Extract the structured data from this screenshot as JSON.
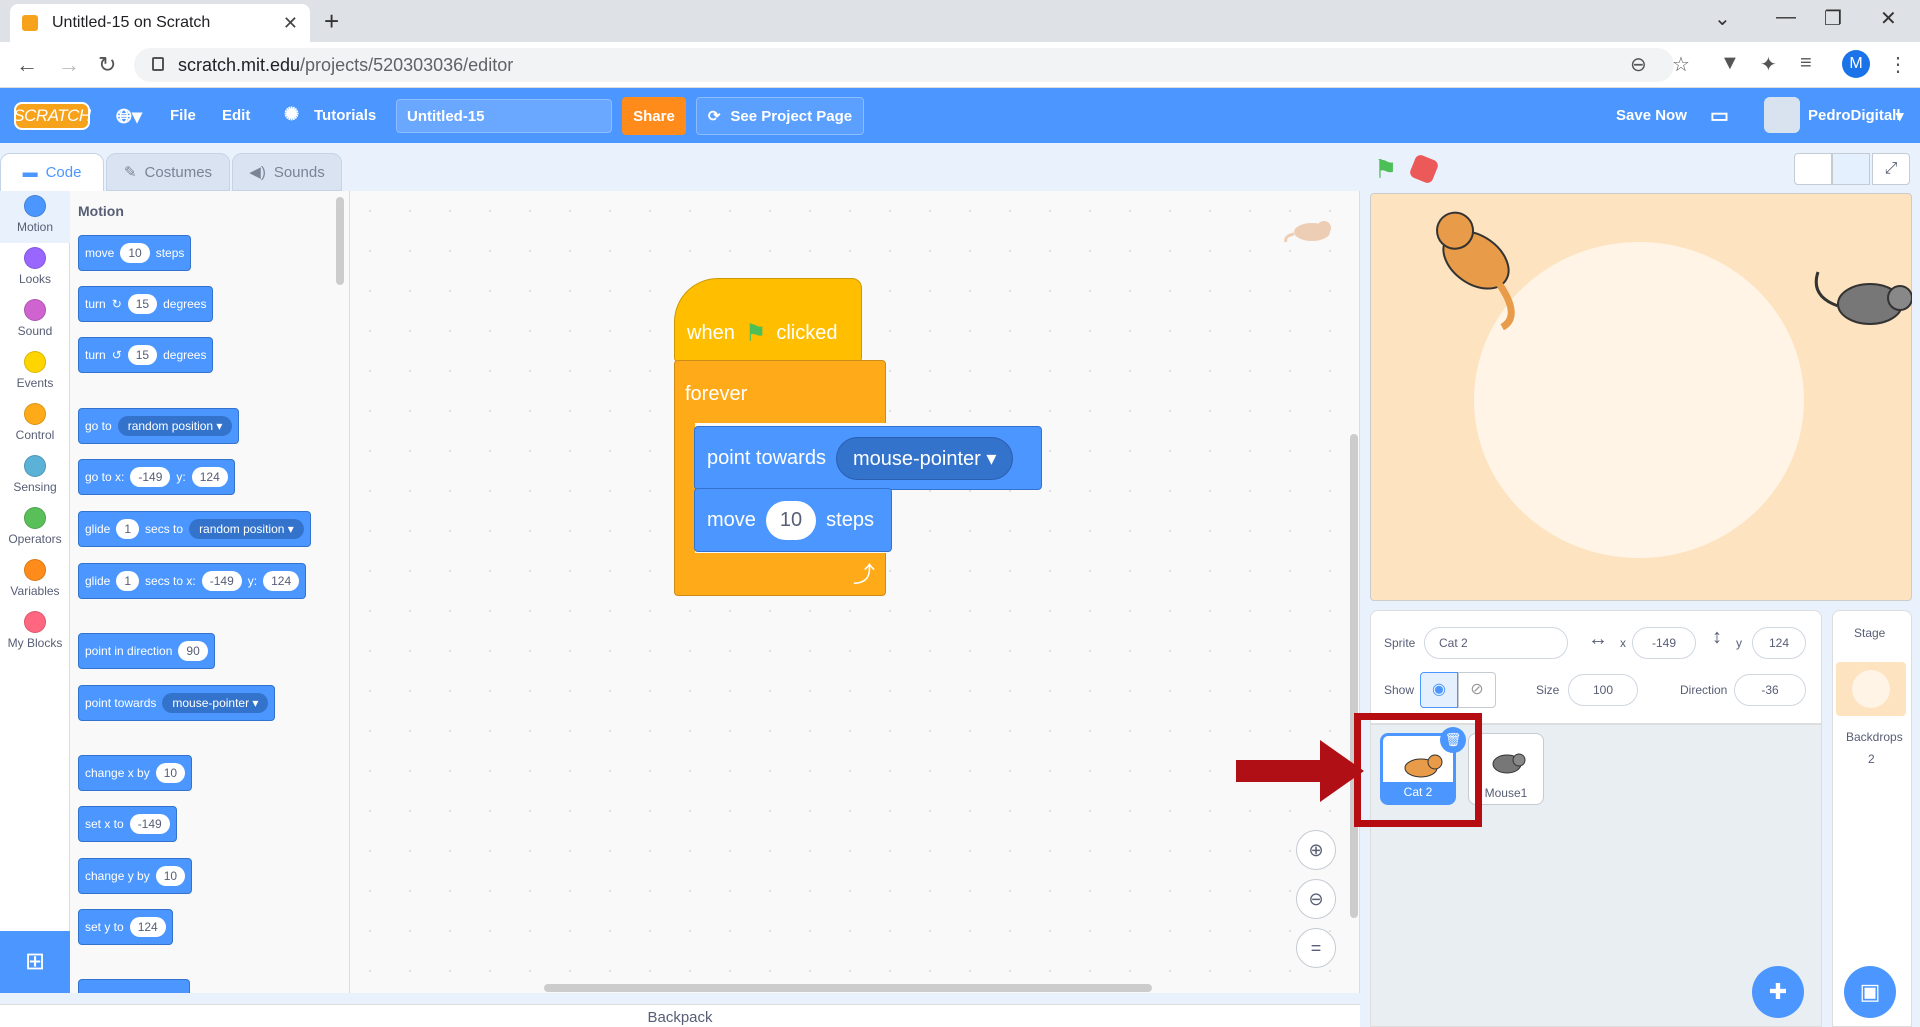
{
  "browser": {
    "tab_title": "Untitled-15 on Scratch",
    "new_tab": "+",
    "close_tab": "✕",
    "url_host": "scratch.mit.edu",
    "url_path": "/projects/520303036/editor",
    "profile_initial": "M"
  },
  "menubar": {
    "logo": "SCRATCH",
    "file": "File",
    "edit": "Edit",
    "tutorials": "Tutorials",
    "project_title": "Untitled-15",
    "share": "Share",
    "see_project_page": "See Project Page",
    "save_now": "Save Now",
    "username": "PedroDigitall"
  },
  "tabs": [
    "Code",
    "Costumes",
    "Sounds"
  ],
  "categories": [
    {
      "label": "Motion",
      "color": "#4c97ff"
    },
    {
      "label": "Looks",
      "color": "#9966ff"
    },
    {
      "label": "Sound",
      "color": "#cf63cf"
    },
    {
      "label": "Events",
      "color": "#ffd500"
    },
    {
      "label": "Control",
      "color": "#ffab19"
    },
    {
      "label": "Sensing",
      "color": "#5cb1d6"
    },
    {
      "label": "Operators",
      "color": "#59c059"
    },
    {
      "label": "Variables",
      "color": "#ff8c1a"
    },
    {
      "label": "My Blocks",
      "color": "#ff6680"
    }
  ],
  "palette": {
    "title": "Motion",
    "move": {
      "a": "move",
      "v": "10",
      "b": "steps"
    },
    "turn_right": {
      "a": "turn",
      "v": "15",
      "b": "degrees"
    },
    "turn_left": {
      "a": "turn",
      "v": "15",
      "b": "degrees"
    },
    "goto": {
      "a": "go to",
      "dd": "random position"
    },
    "goto_xy": {
      "a": "go to x:",
      "x": "-149",
      "y_lbl": "y:",
      "y": "124"
    },
    "glide": {
      "a": "glide",
      "v": "1",
      "b": "secs to",
      "dd": "random position"
    },
    "glide_xy": {
      "a": "glide",
      "v": "1",
      "b": "secs to x:",
      "x": "-149",
      "y_lbl": "y:",
      "y": "124"
    },
    "point_dir": {
      "a": "point in direction",
      "v": "90"
    },
    "point_towards": {
      "a": "point towards",
      "dd": "mouse-pointer"
    },
    "change_x": {
      "a": "change x by",
      "v": "10"
    },
    "set_x": {
      "a": "set x to",
      "v": "-149"
    },
    "change_y": {
      "a": "change y by",
      "v": "10"
    },
    "set_y": {
      "a": "set y to",
      "v": "124"
    }
  },
  "script": {
    "when": "when",
    "clicked": "clicked",
    "forever": "forever",
    "point_towards": "point towards",
    "point_target": "mouse-pointer",
    "move": "move",
    "move_steps": "10",
    "steps": "steps"
  },
  "backpack": "Backpack",
  "sprite_info": {
    "sprite_label": "Sprite",
    "sprite_name": "Cat 2",
    "x_label": "x",
    "x": "-149",
    "y_label": "y",
    "y": "124",
    "show_label": "Show",
    "size_label": "Size",
    "size": "100",
    "direction_label": "Direction",
    "direction": "-36"
  },
  "sprites": [
    "Cat 2",
    "Mouse1"
  ],
  "stage_panel": {
    "title": "Stage",
    "backdrops_label": "Backdrops",
    "backdrops_count": "2"
  },
  "icons": {
    "highlight_color": "#b50d12",
    "flag_color": "#4cbf56",
    "stop_color": "#ec5959"
  }
}
